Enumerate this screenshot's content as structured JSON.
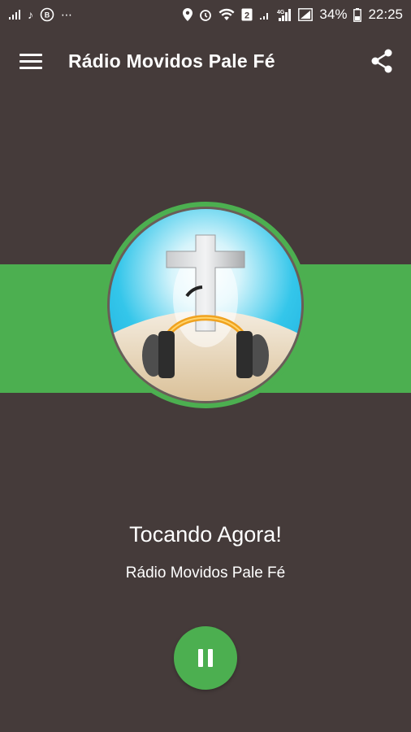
{
  "statusbar": {
    "left_icons": [
      "signal-icon",
      "music-note-icon",
      "b-circle-icon",
      "more-icon"
    ],
    "battery_percent": "34%",
    "time": "22:25"
  },
  "toolbar": {
    "title": "Rádio Movidos Pale Fé"
  },
  "player": {
    "now_playing_label": "Tocando Agora!",
    "station_name": "Rádio Movidos Pale Fé",
    "state": "playing"
  },
  "colors": {
    "background": "#453b3a",
    "accent_green": "#4caf50"
  }
}
